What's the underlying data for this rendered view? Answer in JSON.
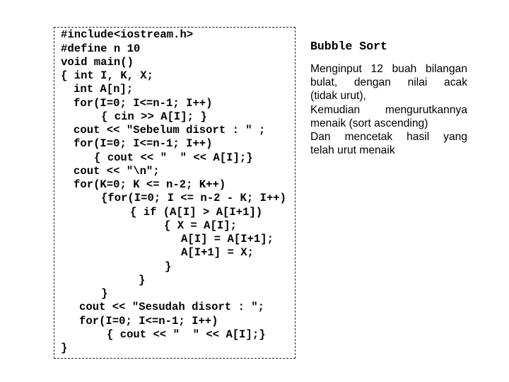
{
  "code_panel": {
    "language": "C++",
    "lines": [
      "#include<iostream.h>",
      "#define n 10",
      "void main()",
      "{ int I, K, X;",
      "int A[n];",
      "for(I=0; I<=n-1; I++)",
      "{ cin >> A[I]; }",
      "cout << \"Sebelum disort : \" ;",
      "for(I=0; I<=n-1; I++)",
      "{ cout << \"  \" << A[I];}",
      "cout << \"\\n\";",
      "for(K=0; K <= n-2; K++)",
      "{for(I=0; I <= n-2 - K; I++)",
      "{ if (A[I] > A[I+1])",
      "{ X = A[I];",
      "A[I] = A[I+1];",
      "A[I+1] = X;",
      "}",
      "}",
      "}",
      "cout << \"Sesudah disort : \";",
      "for(I=0; I<=n-1; I++)",
      "{ cout << \"  \" << A[I];}",
      "}"
    ]
  },
  "side_panel": {
    "title": "Bubble Sort",
    "description_lines": [
      "Menginput 12 buah bilangan",
      "bulat, dengan nilai acak",
      "(tidak urut),",
      "Kemudian mengurutkannya",
      "menaik (sort ascending)",
      "Dan mencetak hasil yang",
      "telah urut menaik"
    ]
  }
}
